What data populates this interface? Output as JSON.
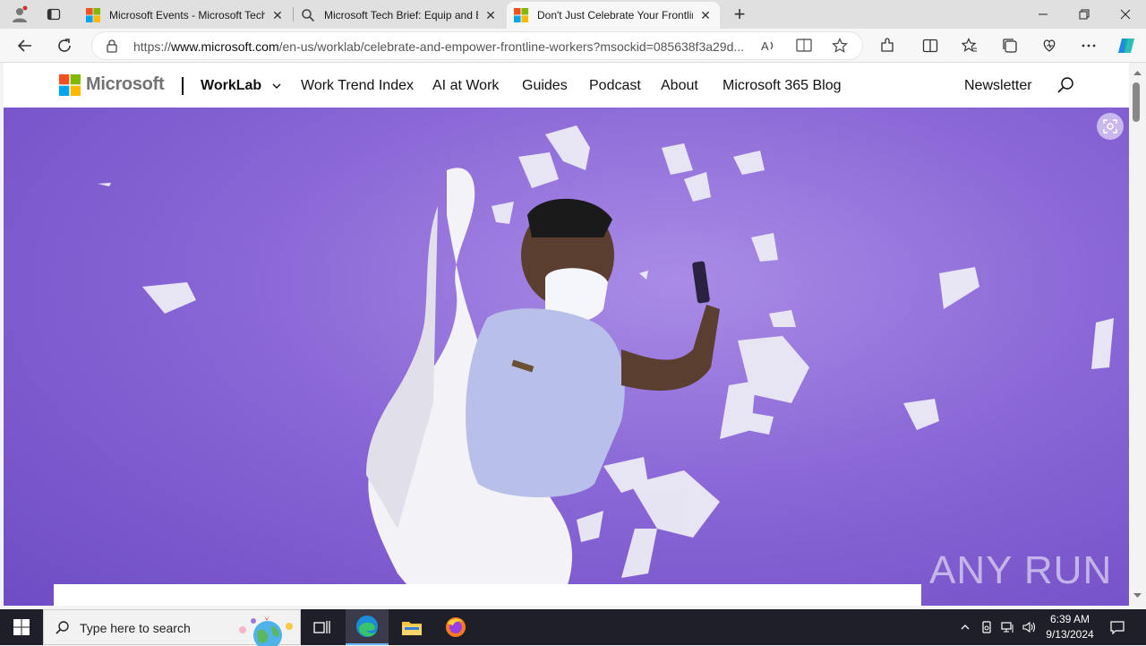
{
  "browser": {
    "tabs": [
      {
        "title": "Microsoft Events - Microsoft Tech",
        "active": false
      },
      {
        "title": "Microsoft Tech Brief: Equip and E",
        "active": false
      },
      {
        "title": "Don't Just Celebrate Your Frontlin",
        "active": true
      }
    ],
    "new_tab_label": "+",
    "url_prefix": "https://",
    "url_domain": "www.microsoft.com",
    "url_path": "/en-us/worklab/celebrate-and-empower-frontline-workers?msockid=085638f3a29d..."
  },
  "site": {
    "brand": "Microsoft",
    "section": "WorkLab",
    "nav": [
      "Work Trend Index",
      "AI at Work",
      "Guides",
      "Podcast",
      "About",
      "Microsoft 365 Blog"
    ],
    "newsletter": "Newsletter"
  },
  "watermark": "ANY RUN",
  "taskbar": {
    "search_placeholder": "Type here to search",
    "time": "6:39 AM",
    "date": "9/13/2024"
  },
  "colors": {
    "hero": "#8a67d6",
    "taskbar": "#1f1f2a"
  }
}
